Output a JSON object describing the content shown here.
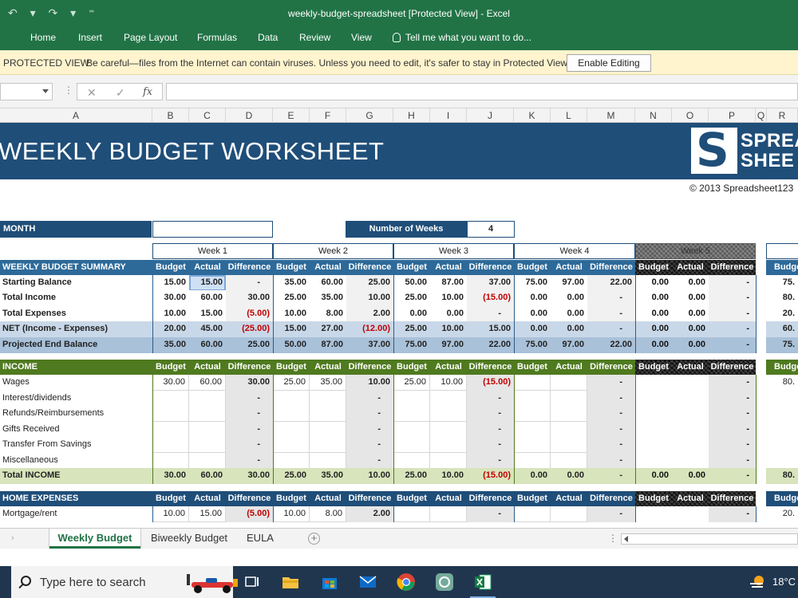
{
  "window": {
    "title": "weekly-budget-spreadsheet  [Protected View] - Excel"
  },
  "ribbon": {
    "tabs": [
      "Home",
      "Insert",
      "Page Layout",
      "Formulas",
      "Data",
      "Review",
      "View"
    ],
    "tell_me": "Tell me what you want to do..."
  },
  "protected_view": {
    "label": "PROTECTED VIEW",
    "message": "Be careful—files from the Internet can contain viruses. Unless you need to edit, it's safer to stay in Protected View.",
    "button": "Enable Editing"
  },
  "formula_bar": {
    "cancel_symbol": "✕",
    "enter_symbol": "✓",
    "fx_symbol": "fx"
  },
  "columns": [
    "A",
    "B",
    "C",
    "D",
    "E",
    "F",
    "G",
    "H",
    "I",
    "J",
    "K",
    "L",
    "M",
    "N",
    "O",
    "P",
    "Q",
    "R"
  ],
  "sheet": {
    "title": "WEEKLY BUDGET WORKSHEET",
    "logo_line1": "SPREA",
    "logo_line2": "SHEE",
    "copyright": "© 2013 Spreadsheet123",
    "month_label": "MONTH",
    "weeks_label": "Number of Weeks",
    "weeks_value": "4",
    "week_headers": [
      "Week 1",
      "Week 2",
      "Week 3",
      "Week 4",
      "Week 5"
    ],
    "col_labels": {
      "budget": "Budget",
      "actual": "Actual",
      "difference": "Difference",
      "budget_trunc": "Budge"
    },
    "summary": {
      "heading": "WEEKLY BUDGET SUMMARY",
      "rows": [
        {
          "label": "Starting Balance",
          "cells": [
            "15.00",
            "15.00",
            "-",
            "35.00",
            "60.00",
            "25.00",
            "50.00",
            "87.00",
            "37.00",
            "75.00",
            "97.00",
            "22.00",
            "0.00",
            "0.00",
            "-",
            "75."
          ]
        },
        {
          "label": "Total Income",
          "cells": [
            "30.00",
            "60.00",
            "30.00",
            "25.00",
            "35.00",
            "10.00",
            "25.00",
            "10.00",
            "(15.00)",
            "0.00",
            "0.00",
            "-",
            "0.00",
            "0.00",
            "-",
            "80."
          ]
        },
        {
          "label": "Total Expenses",
          "cells": [
            "10.00",
            "15.00",
            "(5.00)",
            "10.00",
            "8.00",
            "2.00",
            "0.00",
            "0.00",
            "-",
            "0.00",
            "0.00",
            "-",
            "0.00",
            "0.00",
            "-",
            "20."
          ]
        },
        {
          "label": "NET (Income - Expenses)",
          "cells": [
            "20.00",
            "45.00",
            "(25.00)",
            "15.00",
            "27.00",
            "(12.00)",
            "25.00",
            "10.00",
            "15.00",
            "0.00",
            "0.00",
            "-",
            "0.00",
            "0.00",
            "-",
            "60."
          ]
        },
        {
          "label": "Projected End Balance",
          "cells": [
            "35.00",
            "60.00",
            "25.00",
            "50.00",
            "87.00",
            "37.00",
            "75.00",
            "97.00",
            "22.00",
            "75.00",
            "97.00",
            "22.00",
            "0.00",
            "0.00",
            "-",
            "75."
          ]
        }
      ]
    },
    "income": {
      "heading": "INCOME",
      "rows": [
        {
          "label": "Wages",
          "cells": [
            "30.00",
            "60.00",
            "30.00",
            "25.00",
            "35.00",
            "10.00",
            "25.00",
            "10.00",
            "(15.00)",
            "",
            "",
            "-",
            "",
            "",
            "-",
            "80."
          ]
        },
        {
          "label": "Interest/dividends",
          "cells": [
            "",
            "",
            "-",
            "",
            "",
            "-",
            "",
            "",
            "-",
            "",
            "",
            "-",
            "",
            "",
            "-",
            ""
          ]
        },
        {
          "label": "Refunds/Reimbursements",
          "cells": [
            "",
            "",
            "-",
            "",
            "",
            "-",
            "",
            "",
            "-",
            "",
            "",
            "-",
            "",
            "",
            "-",
            ""
          ]
        },
        {
          "label": "Gifts Received",
          "cells": [
            "",
            "",
            "-",
            "",
            "",
            "-",
            "",
            "",
            "-",
            "",
            "",
            "-",
            "",
            "",
            "-",
            ""
          ]
        },
        {
          "label": "Transfer From Savings",
          "cells": [
            "",
            "",
            "-",
            "",
            "",
            "-",
            "",
            "",
            "-",
            "",
            "",
            "-",
            "",
            "",
            "-",
            ""
          ]
        },
        {
          "label": "Miscellaneous",
          "cells": [
            "",
            "",
            "-",
            "",
            "",
            "-",
            "",
            "",
            "-",
            "",
            "",
            "-",
            "",
            "",
            "-",
            ""
          ]
        }
      ],
      "total": {
        "label": "Total INCOME",
        "cells": [
          "30.00",
          "60.00",
          "30.00",
          "25.00",
          "35.00",
          "10.00",
          "25.00",
          "10.00",
          "(15.00)",
          "0.00",
          "0.00",
          "-",
          "0.00",
          "0.00",
          "-",
          "80."
        ]
      }
    },
    "home_expenses": {
      "heading": "HOME EXPENSES",
      "rows": [
        {
          "label": "Mortgage/rent",
          "cells": [
            "10.00",
            "15.00",
            "(5.00)",
            "10.00",
            "8.00",
            "2.00",
            "",
            "",
            "-",
            "",
            "",
            "-",
            "",
            "",
            "-",
            "20."
          ]
        }
      ]
    }
  },
  "sheet_tabs": [
    "Weekly Budget",
    "Biweekly Budget",
    "EULA"
  ],
  "sheet_tab_add": "+",
  "taskbar": {
    "search_placeholder": "Type here to search",
    "temperature": "18°C"
  },
  "colors": {
    "excel_green": "#217346",
    "summary_blue": "#1f4e79",
    "income_green": "#4f7a1f",
    "negative_red": "#c00000"
  }
}
